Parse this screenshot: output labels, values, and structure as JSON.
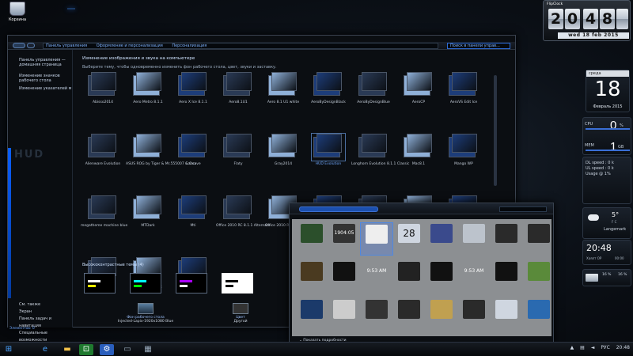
{
  "desktop": {
    "recycle_bin_label": "Корзина"
  },
  "window": {
    "breadcrumb": [
      "Панель управления",
      "Оформление и персонализация",
      "Персонализация"
    ],
    "search_placeholder": "Поиск в панели управ...",
    "sidebar_links": [
      "Панель управления — домашняя страница",
      "Изменение значков рабочего стола",
      "Изменение указателей мыши"
    ],
    "sidebar_see_also": [
      "См. также",
      "Экран",
      "Панель задач и навигация",
      "Специальные возможности"
    ],
    "heading": "Изменение изображения и звука на компьютере",
    "subheading": "Выберите тему, чтобы одновременно изменить фон рабочего стола, цвет, звуки и заставку.",
    "themes": [
      "Abisso2014",
      "Aero Metro 8.1.1",
      "Aero X Ice 8.1.1",
      "Aero8.1U1",
      "Aero 8.1 U1 white",
      "AeroByDesignBlack",
      "AeroByDesignBlue",
      "AeroCP",
      "AeroVS Edit Ice",
      "Alienware Evolution",
      "ASUS ROG by Tiger & Mr.555007 & Ova",
      "Concave",
      "Flaty",
      "Gray2014",
      "HUD Evolution",
      "Longhorn Evolution 8.1.1 Classic",
      "Mac8.1",
      "Mango WP",
      "megatheme machine blue",
      "MTDark",
      "Mti",
      "Office 2010 RC 8.1.1 Alternate",
      "Office 2010 RC 8.1.1",
      "Restricted Zone",
      "Snowy8",
      "Steam VS Center",
      "Steam VS Simple",
      "Steam VS",
      "Verbatt Honoric",
      "Vista VS Square"
    ],
    "high_contrast_title": "Высококонтрастные темы (4)",
    "bottom": {
      "wallpaper_label": "Фон рабочего стола",
      "wallpaper_value": "Injected-Lapix-1920x1080 Blue",
      "color_label": "Цвет",
      "color_value": "Другой"
    },
    "status": "Элементов: 0"
  },
  "gallery": {
    "gadgets": [
      "",
      "",
      "",
      "",
      "",
      "",
      "",
      "",
      "",
      "",
      "",
      "",
      "",
      "",
      "",
      ""
    ],
    "times": [
      "9:53 AM",
      "9:53 AM"
    ],
    "calendar_day": "28",
    "clock_digits": "1904:05",
    "show_details": "Показать подробности"
  },
  "widgets": {
    "flip_top": "FlipClock",
    "flip_digits": [
      "2",
      "0",
      "4",
      "8"
    ],
    "flip_date": "wed 18 feb 2015",
    "cal_head": "среда",
    "cal_day": "18",
    "cal_month": "Февраль 2015",
    "cpu_label": "CPU",
    "cpu_value": "0",
    "cpu_unit": "%",
    "mem_label": "MEM",
    "mem_value": "1",
    "mem_unit": "GB",
    "net": [
      "DL speed : 0 k",
      "UL speed : 0 k",
      "Usage @ 1%"
    ],
    "temp": "5°",
    "temp_unit": "F  C",
    "city": "Langemark",
    "time": "20:48",
    "clock_sub": "Хаялт ОР",
    "clock_sec": "00:00",
    "drive_pct": "16 %",
    "drive_free": "16 %"
  },
  "taskbar": {
    "lang": "РУС",
    "time": "20:48"
  }
}
